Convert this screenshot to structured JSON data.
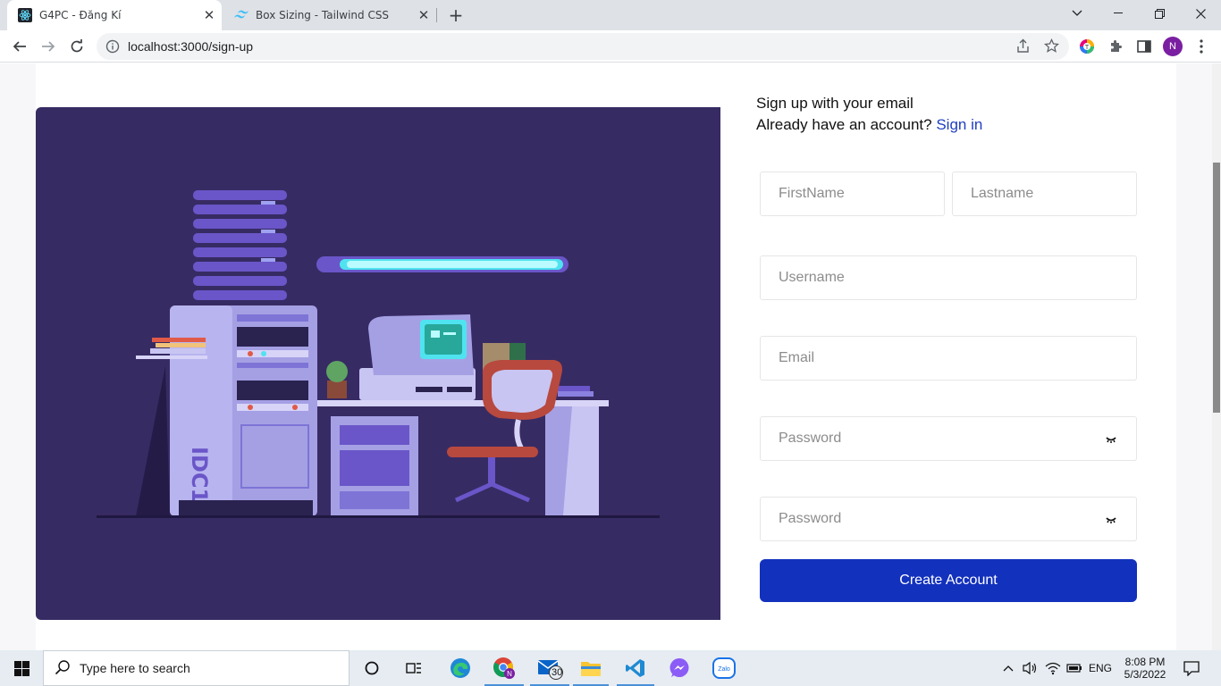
{
  "browser": {
    "tabs": [
      {
        "title": "G4PC - Đăng Kí",
        "active": true
      },
      {
        "title": "Box Sizing - Tailwind CSS",
        "active": false
      }
    ],
    "url": "localhost:3000/sign-up",
    "profile_initial": "N"
  },
  "signup": {
    "heading": "Sign up with your email",
    "have_account": "Already have an account?",
    "signin_link": "Sign in",
    "firstname_placeholder": "FirstName",
    "lastname_placeholder": "Lastname",
    "username_placeholder": "Username",
    "email_placeholder": "Email",
    "password_placeholder": "Password",
    "confirm_placeholder": "Password",
    "submit_label": "Create Account"
  },
  "colors": {
    "primary": "#1231bd",
    "link": "#1f3fbf",
    "illustration_bg": "#372b63"
  },
  "taskbar": {
    "search_placeholder": "Type here to search",
    "mail_badge": "30",
    "language": "ENG",
    "time": "8:08 PM",
    "date": "5/3/2022"
  }
}
